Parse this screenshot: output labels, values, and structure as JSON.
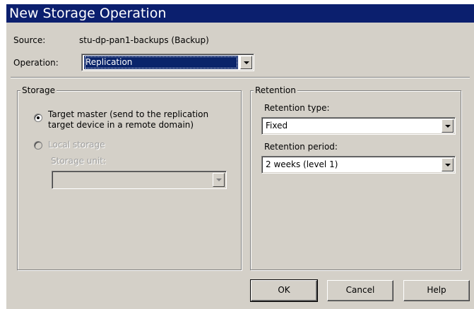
{
  "dialog": {
    "title": "New Storage Operation"
  },
  "source": {
    "label": "Source:",
    "value": "stu-dp-pan1-backups (Backup)"
  },
  "operation": {
    "label": "Operation:",
    "value": "Replication"
  },
  "storage": {
    "legend": "Storage",
    "target_master_label": "Target master (send to the replication target device in a remote domain)",
    "target_master_line1": "Target master (send to the replication",
    "target_master_line2": "target device in a remote domain)",
    "target_master_checked": true,
    "local_storage_label": "Local storage",
    "local_storage_checked": false,
    "storage_unit_label": "Storage unit:",
    "storage_unit_value": ""
  },
  "retention": {
    "legend": "Retention",
    "type_label": "Retention type:",
    "type_value": "Fixed",
    "period_label": "Retention period:",
    "period_value": "2 weeks (level 1)"
  },
  "buttons": {
    "ok": "OK",
    "cancel": "Cancel",
    "help": "Help"
  },
  "colors": {
    "titlebar": "#0b1f6e",
    "dialog_bg": "#d4d0c8",
    "selection": "#0a246a"
  }
}
